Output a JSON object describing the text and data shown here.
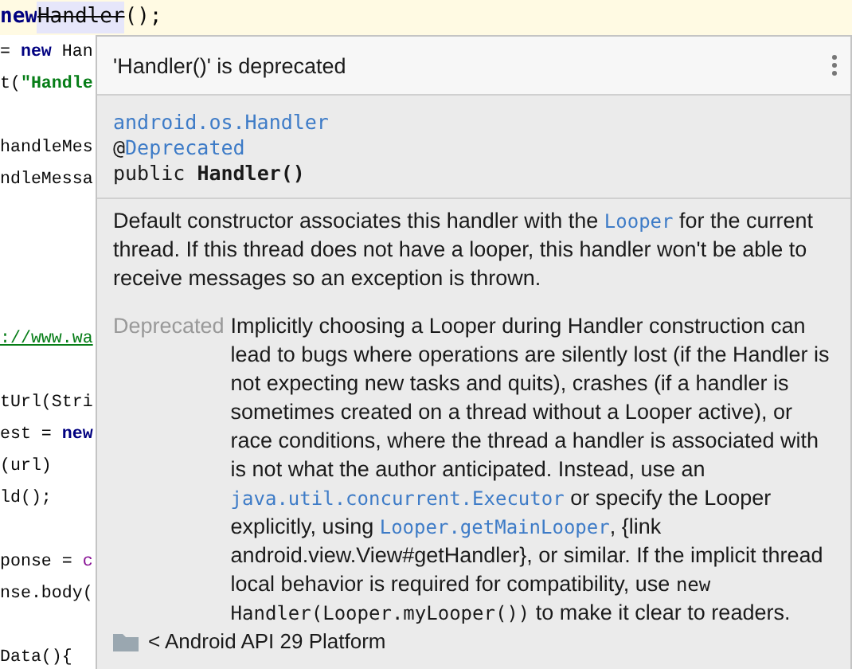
{
  "editor": {
    "current_line": [
      {
        "kind": "keyword",
        "text": "new"
      },
      {
        "kind": "deprecated",
        "text": "Handler"
      },
      {
        "kind": "plain",
        "text": "();"
      }
    ],
    "lines": [
      [
        {
          "kind": "plain",
          "text": "= "
        },
        {
          "kind": "keyword",
          "text": "new"
        },
        {
          "kind": "plain",
          "text": " Han"
        }
      ],
      [
        {
          "kind": "plain",
          "text": "t("
        },
        {
          "kind": "string",
          "text": "\"Handle"
        }
      ],
      [
        {
          "kind": "blank"
        }
      ],
      [
        {
          "kind": "plain",
          "text": "handleMes"
        }
      ],
      [
        {
          "kind": "plain",
          "text": "ndleMessa"
        }
      ],
      [
        {
          "kind": "blank"
        }
      ],
      [
        {
          "kind": "blank"
        }
      ],
      [
        {
          "kind": "blank"
        }
      ],
      [
        {
          "kind": "blank"
        }
      ],
      [
        {
          "kind": "link",
          "text": "://www.wa"
        }
      ],
      [
        {
          "kind": "blank"
        }
      ],
      [
        {
          "kind": "plain",
          "text": "tUrl(Stri"
        }
      ],
      [
        {
          "kind": "plain",
          "text": "est = "
        },
        {
          "kind": "keyword",
          "text": "new"
        }
      ],
      [
        {
          "kind": "plain",
          "text": "(url)"
        }
      ],
      [
        {
          "kind": "plain",
          "text": "ld();"
        }
      ],
      [
        {
          "kind": "blank"
        }
      ],
      [
        {
          "kind": "plain",
          "text": "ponse = "
        },
        {
          "kind": "field",
          "text": "c"
        }
      ],
      [
        {
          "kind": "plain",
          "text": "nse.body("
        }
      ],
      [
        {
          "kind": "blank"
        }
      ],
      [
        {
          "kind": "plain",
          "text": "Data(){"
        }
      ]
    ]
  },
  "popup": {
    "title": "'Handler()' is deprecated",
    "signature": [
      [
        {
          "kind": "link",
          "text": "android.os.Handler"
        }
      ],
      [
        {
          "kind": "plain",
          "text": "@"
        },
        {
          "kind": "link",
          "text": "Deprecated"
        }
      ],
      [
        {
          "kind": "plain",
          "text": "public "
        },
        {
          "kind": "bold",
          "text": "Handler()"
        }
      ]
    ],
    "description": [
      {
        "kind": "text",
        "text": "Default constructor associates this handler with the "
      },
      {
        "kind": "code_link",
        "text": "Looper"
      },
      {
        "kind": "text",
        "text": " for the current thread. If this thread does not have a looper, this handler won't be able to receive messages so an exception is thrown."
      }
    ],
    "deprecated": {
      "label": "Deprecated",
      "body": [
        {
          "kind": "text",
          "text": "Implicitly choosing a Looper during Handler construction can lead to bugs where operations are silently lost (if the Handler is not expecting new tasks and quits), crashes (if a handler is sometimes created on a thread without a Looper active), or race conditions, where the thread a handler is associated with is not what the author anticipated. Instead, use an "
        },
        {
          "kind": "code_link",
          "text": "java.util.concurrent.Executor"
        },
        {
          "kind": "text",
          "text": " or specify the Looper explicitly, using "
        },
        {
          "kind": "code_link",
          "text": "Looper.getMainLooper"
        },
        {
          "kind": "text",
          "text": ", {link android.view.View#getHandler}, or similar. If the implicit thread local behavior is required for compatibility, use "
        },
        {
          "kind": "code",
          "text": "new Handler(Looper.myLooper())"
        },
        {
          "kind": "text",
          "text": " to make it clear to readers."
        }
      ]
    },
    "footer": "< Android API 29 Platform"
  }
}
